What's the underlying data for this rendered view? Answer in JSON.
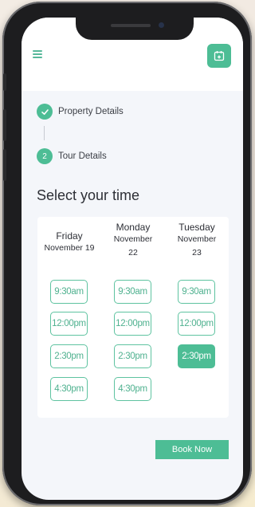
{
  "header": {
    "menu_icon": "hamburger-menu-icon",
    "calendar_icon": "calendar-add-icon"
  },
  "steps": [
    {
      "label": "Property Details",
      "status": "completed",
      "indicator": "check-icon"
    },
    {
      "label": "Tour Details",
      "status": "current",
      "number": "2"
    }
  ],
  "section_title": "Select your time",
  "days": [
    {
      "name": "Friday",
      "date": "November 19",
      "slots": [
        "9:30am",
        "12:00pm",
        "2:30pm",
        "4:30pm"
      ]
    },
    {
      "name": "Monday",
      "date_line1": "November",
      "date_line2": "22",
      "slots": [
        "9:30am",
        "12:00pm",
        "2:30pm",
        "4:30pm"
      ]
    },
    {
      "name": "Tuesday",
      "date_line1": "November",
      "date_line2": "23",
      "slots": [
        "9:30am",
        "12:00pm",
        "2:30pm"
      ]
    }
  ],
  "selected_slot": {
    "day": "Tuesday",
    "time": "2:30pm"
  },
  "book_button_label": "Book Now",
  "colors": {
    "accent": "#4dbd95",
    "background": "#f4f6fa",
    "card": "#ffffff"
  }
}
